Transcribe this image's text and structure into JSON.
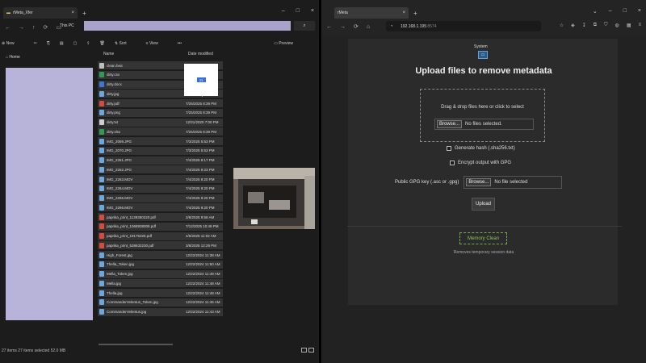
{
  "explorer": {
    "tab_title": "rMeta_Xfer",
    "breadcrumb": "This PC",
    "toolbar": {
      "new": "New",
      "sort": "Sort",
      "view": "View",
      "more": "•••",
      "preview": "Preview"
    },
    "nav_home": "Home",
    "columns": {
      "name": "Name",
      "date": "Date modified"
    },
    "files": [
      {
        "name": "clean.heic",
        "date": "",
        "color": "#bfbfbf"
      },
      {
        "name": "dirty.csv",
        "date": "",
        "color": "#2e9b57"
      },
      {
        "name": "dirty.docx",
        "date": "",
        "color": "#3a78d8"
      },
      {
        "name": "dirty.jpg",
        "date": "",
        "color": "#6aa8e0"
      },
      {
        "name": "dirty.pdf",
        "date": "7/25/2025 8:39 PM",
        "color": "#d84a3a"
      },
      {
        "name": "dirty.png",
        "date": "7/25/2025 8:39 PM",
        "color": "#6aa8e0"
      },
      {
        "name": "dirty.txt",
        "date": "12/31/2020 7:00 PM",
        "color": "#cfcfcf"
      },
      {
        "name": "dirty.xlsx",
        "date": "7/25/2025 8:39 PM",
        "color": "#2e9b57"
      },
      {
        "name": "IMG_2069.JPG",
        "date": "7/3/2025 5:53 PM",
        "color": "#6aa8e0"
      },
      {
        "name": "IMG_2070.JPG",
        "date": "7/3/2025 5:53 PM",
        "color": "#6aa8e0"
      },
      {
        "name": "IMG_2261.JPG",
        "date": "7/4/2025 9:17 PM",
        "color": "#6aa8e0"
      },
      {
        "name": "IMG_2262.JPG",
        "date": "7/4/2025 9:23 PM",
        "color": "#6aa8e0"
      },
      {
        "name": "IMG_2263.MOV",
        "date": "7/4/2025 9:20 PM",
        "color": "#6aa8e0"
      },
      {
        "name": "IMG_2264.MOV",
        "date": "7/4/2025 9:20 PM",
        "color": "#6aa8e0"
      },
      {
        "name": "IMG_2265.MOV",
        "date": "7/4/2025 9:20 PM",
        "color": "#6aa8e0"
      },
      {
        "name": "IMG_2266.MOV",
        "date": "7/4/2025 9:20 PM",
        "color": "#6aa8e0"
      },
      {
        "name": "paprika_print_1139350220.pdf",
        "date": "2/8/2025 9:58 AM",
        "color": "#d84a3a"
      },
      {
        "name": "paprika_print_1068938008.pdf",
        "date": "7/12/2025 10:49 PM",
        "color": "#d84a3a"
      },
      {
        "name": "paprika_print_19175325.pdf",
        "date": "4/5/2025 11:02 AM",
        "color": "#d84a3a"
      },
      {
        "name": "paprika_print_538632230.pdf",
        "date": "3/8/2025 12:29 PM",
        "color": "#d84a3a"
      },
      {
        "name": "High_Forest.jpg",
        "date": "12/22/2024 11:38 AM",
        "color": "#6aa8e0"
      },
      {
        "name": "Thella_Token.jpg",
        "date": "12/22/2024 11:50 AM",
        "color": "#6aa8e0"
      },
      {
        "name": "Mella_Token.jpg",
        "date": "12/22/2024 11:49 AM",
        "color": "#6aa8e0"
      },
      {
        "name": "Mella.jpg",
        "date": "12/22/2024 11:48 AM",
        "color": "#6aa8e0"
      },
      {
        "name": "Thella.jpg",
        "date": "12/22/2024 11:48 AM",
        "color": "#6aa8e0"
      },
      {
        "name": "CommanderVelentus_Token.jpg",
        "date": "12/22/2024 11:45 AM",
        "color": "#6aa8e0"
      },
      {
        "name": "CommanderVelentus.jpg",
        "date": "12/22/2024 11:43 AM",
        "color": "#6aa8e0"
      }
    ],
    "drag_badge": "23",
    "status": "27 items   27 items selected  52.0 MB"
  },
  "browser": {
    "tab_title": "rMeta",
    "url_host": "192.168.1.195",
    "url_port": ":8574",
    "system_label": "System",
    "heading": "Upload files to remove metadata",
    "dropzone_text": "Drag & drop files here or click to select",
    "browse_label": "Browse...",
    "no_files_text": "No files selected.",
    "hash_label": "Generate hash (.sha256.txt)",
    "gpg_encrypt_label": "Encrypt output with GPG",
    "gpg_key_label": "Public GPG key (.asc or .gpg)",
    "no_file_selected_text": "No file selected",
    "upload_label": "Upload",
    "memory_clean_label": "Memory Clean",
    "memory_clean_sub": "Removes temporary session data"
  },
  "colors": {
    "selection": "#b8b3d8",
    "accent_green": "#8fc060",
    "accent_blue": "#2a5b8a"
  }
}
